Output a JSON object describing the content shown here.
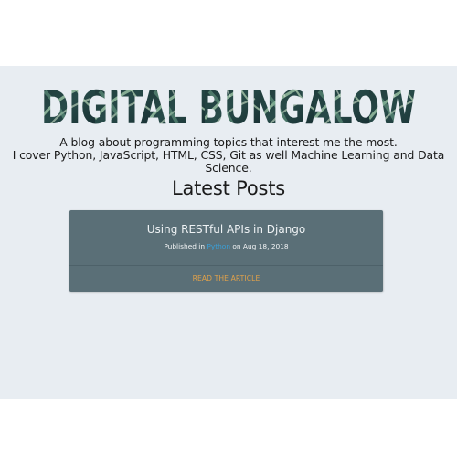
{
  "site": {
    "title": "DIGITAL BUNGALOW",
    "tagline_line1": "A blog about programming topics that interest me the most.",
    "tagline_line2": "I cover Python, JavaScript, HTML, CSS, Git as well Machine Learning and Data Science."
  },
  "posts_section": {
    "heading": "Latest Posts"
  },
  "posts": [
    {
      "title": "Using RESTful APIs in Django",
      "published_prefix": "Published in",
      "category": "Python",
      "date_text": "on Aug 18, 2018",
      "link_label": "READ THE ARTICLE"
    }
  ],
  "colors": {
    "background": "#e8edf2",
    "card": "#5a6f77",
    "link": "#e0a14a",
    "category": "#3aa0d8"
  }
}
